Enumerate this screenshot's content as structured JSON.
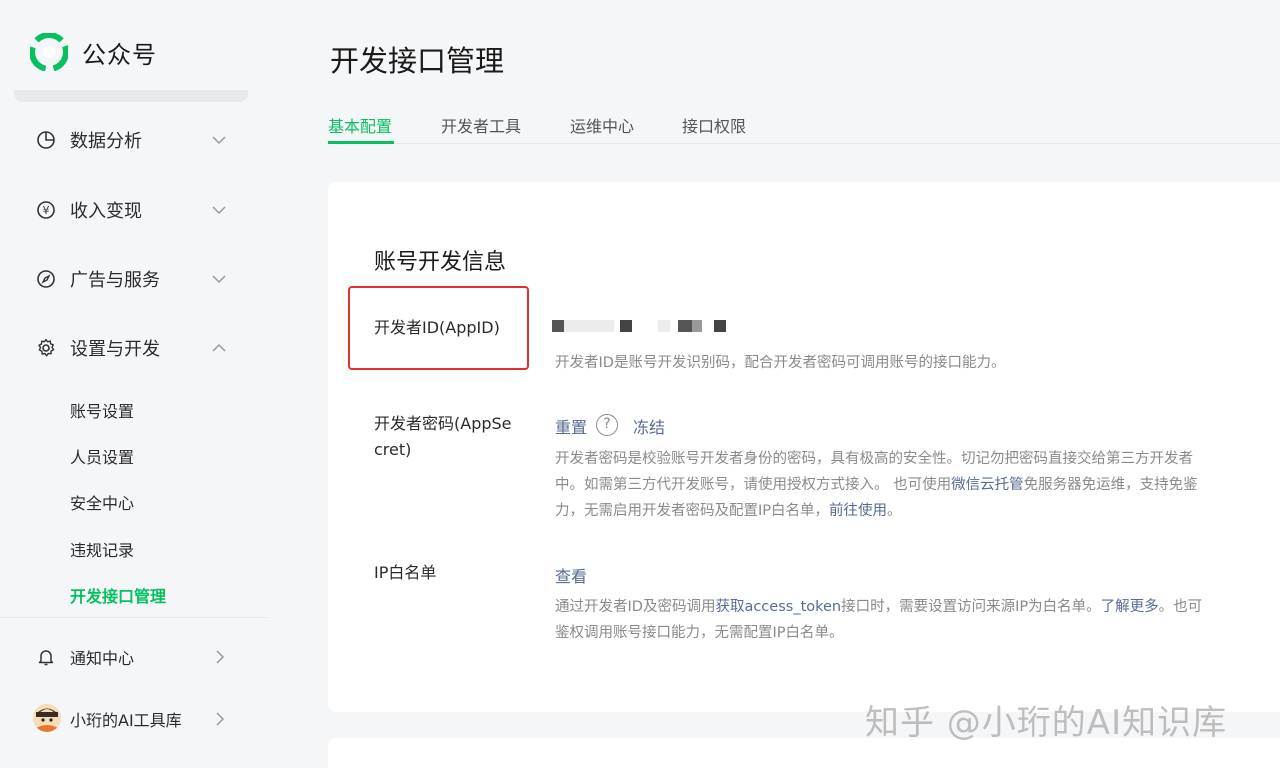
{
  "sidebar": {
    "brand_name": "公众号",
    "groups": [
      {
        "label": "数据分析",
        "icon": "pie-chart-icon"
      },
      {
        "label": "收入变现",
        "icon": "yen-icon"
      },
      {
        "label": "广告与服务",
        "icon": "compass-icon"
      },
      {
        "label": "设置与开发",
        "icon": "gear-icon"
      }
    ],
    "sub_items": [
      {
        "label": "账号设置"
      },
      {
        "label": "人员设置"
      },
      {
        "label": "安全中心"
      },
      {
        "label": "违规记录"
      },
      {
        "label": "开发接口管理",
        "active": true
      }
    ],
    "notifications_label": "通知中心",
    "account_label": "小珩的AI工具库"
  },
  "main": {
    "title": "开发接口管理",
    "tabs": [
      {
        "label": "基本配置",
        "active": true
      },
      {
        "label": "开发者工具"
      },
      {
        "label": "运维中心"
      },
      {
        "label": "接口权限"
      }
    ],
    "section_title": "账号开发信息",
    "appid": {
      "label": "开发者ID(AppID)",
      "desc": "开发者ID是账号开发识别码，配合开发者密码可调用账号的接口能力。"
    },
    "appsecret": {
      "label_line1": "开发者密码(AppSe",
      "label_line2": "cret)",
      "reset_label": "重置",
      "help_glyph": "?",
      "freeze_label": "冻结",
      "desc_line1": "开发者密码是校验账号开发者身份的密码，具有极高的安全性。切记勿把密码直接交给第三方开发者",
      "desc_line2_a": "中。如需第三方代开发账号，请使用授权方式接入。 也可使用",
      "desc_line2_link": "微信云托管",
      "desc_line2_b": "免服务器免运维，支持免鉴",
      "desc_line3_a": "力，无需启用开发者密码及配置IP白名单，",
      "desc_line3_link": "前往使用",
      "desc_line3_b": "。"
    },
    "ip_whitelist": {
      "label": "IP白名单",
      "view_label": "查看",
      "desc_line1_a": "通过开发者ID及密码调用",
      "desc_line1_link1": "获取access_token",
      "desc_line1_b": "接口时，需要设置访问来源IP为白名单。",
      "desc_line1_link2": "了解更多",
      "desc_line1_c": "。也可",
      "desc_line2": "鉴权调用账号接口能力，无需配置IP白名单。"
    }
  },
  "watermark": "知乎 @小珩的AI知识库",
  "colors": {
    "accent": "#07c160",
    "link": "#576b95",
    "highlight": "#e03131"
  }
}
